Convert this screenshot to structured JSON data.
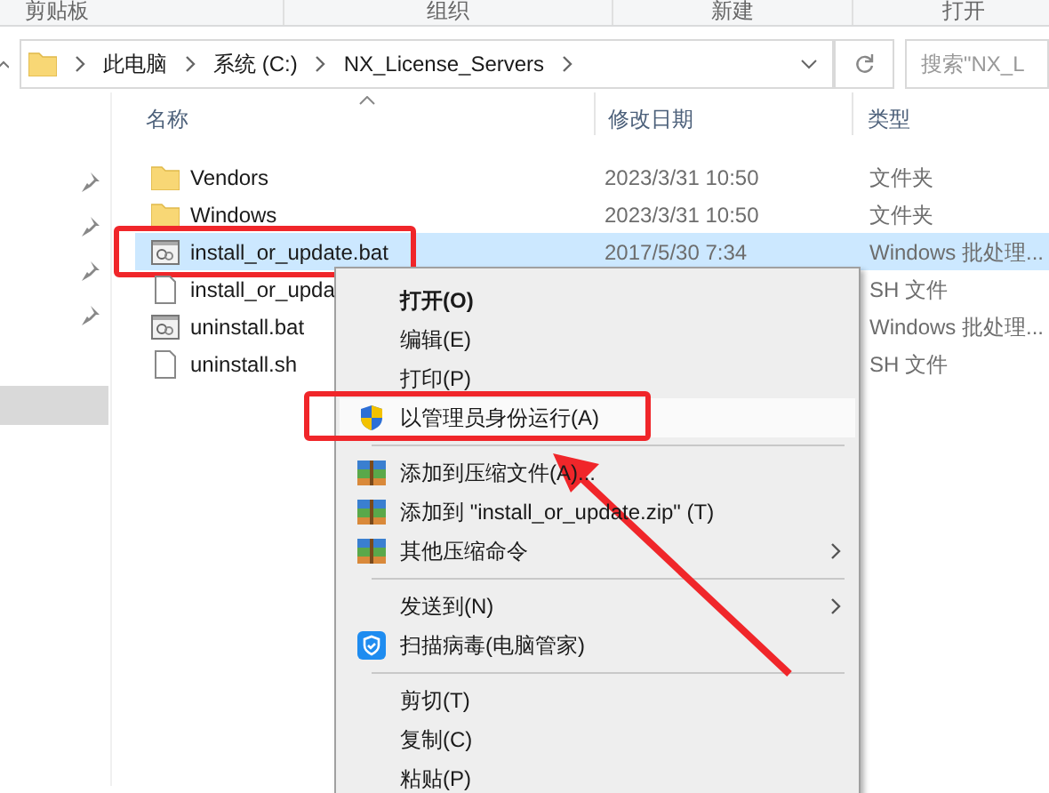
{
  "ribbon_groups": [
    "剪贴板",
    "组织",
    "新建",
    "打开"
  ],
  "address": {
    "crumbs": [
      "此电脑",
      "系统 (C:)",
      "NX_License_Servers"
    ]
  },
  "search": {
    "placeholder": "搜索\"NX_L"
  },
  "columns": [
    "名称",
    "修改日期",
    "类型"
  ],
  "files": [
    {
      "kind": "folder",
      "name": "Vendors",
      "date": "2023/3/31 10:50",
      "type": "文件夹",
      "selected": false,
      "annotated": false
    },
    {
      "kind": "folder",
      "name": "Windows",
      "date": "2023/3/31 10:50",
      "type": "文件夹",
      "selected": false,
      "annotated": false
    },
    {
      "kind": "bat",
      "name": "install_or_update.bat",
      "date": "2017/5/30 7:34",
      "type": "Windows 批处理...",
      "selected": true,
      "annotated": true
    },
    {
      "kind": "sh",
      "name": "install_or_upda",
      "type": "SH 文件",
      "selected": false,
      "annotated": false
    },
    {
      "kind": "bat",
      "name": "uninstall.bat",
      "type": "Windows 批处理...",
      "selected": false,
      "annotated": false
    },
    {
      "kind": "sh",
      "name": "uninstall.sh",
      "type": "SH 文件",
      "selected": false,
      "annotated": false
    }
  ],
  "context_menu": [
    {
      "kind": "plain",
      "label": "打开(O)",
      "bold": true,
      "submenu": false,
      "annotated": false
    },
    {
      "kind": "plain",
      "label": "编辑(E)",
      "bold": false,
      "submenu": false,
      "annotated": false
    },
    {
      "kind": "plain",
      "label": "打印(P)",
      "bold": false,
      "submenu": false,
      "annotated": false
    },
    {
      "kind": "admin",
      "label": "以管理员身份运行(A)",
      "bold": false,
      "submenu": false,
      "annotated": true
    },
    {
      "kind": "separator"
    },
    {
      "kind": "archive",
      "label": "添加到压缩文件(A)...",
      "bold": false,
      "submenu": false,
      "annotated": false
    },
    {
      "kind": "archive",
      "label": "添加到 \"install_or_update.zip\" (T)",
      "bold": false,
      "submenu": false,
      "annotated": false
    },
    {
      "kind": "archive",
      "label": "其他压缩命令",
      "bold": false,
      "submenu": true,
      "annotated": false
    },
    {
      "kind": "separator"
    },
    {
      "kind": "plain",
      "label": "发送到(N)",
      "bold": false,
      "submenu": true,
      "annotated": false
    },
    {
      "kind": "guard",
      "label": "扫描病毒(电脑管家)",
      "bold": false,
      "submenu": false,
      "annotated": false
    },
    {
      "kind": "separator"
    },
    {
      "kind": "plain",
      "label": "剪切(T)",
      "bold": false,
      "submenu": false,
      "annotated": false
    },
    {
      "kind": "plain",
      "label": "复制(C)",
      "bold": false,
      "submenu": false,
      "annotated": false
    },
    {
      "kind": "plain",
      "label": "粘贴(P)",
      "bold": false,
      "submenu": false,
      "annotated": false
    }
  ]
}
